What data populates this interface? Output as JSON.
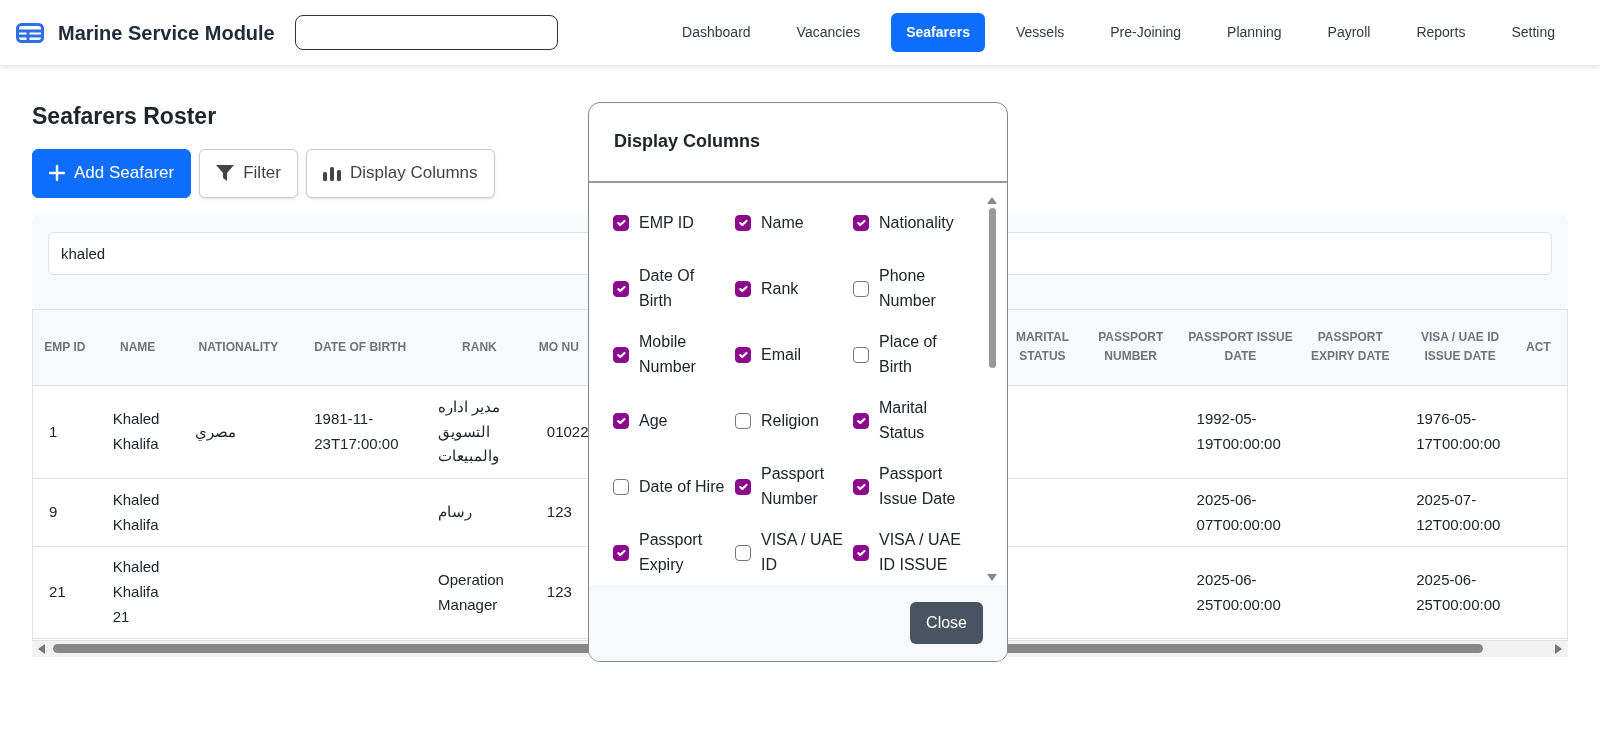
{
  "navbar": {
    "title": "Marine Service Module",
    "links": [
      {
        "label": "Dashboard",
        "selected": false
      },
      {
        "label": "Vacancies",
        "selected": false
      },
      {
        "label": "Seafarers",
        "selected": true
      },
      {
        "label": "Vessels",
        "selected": false
      },
      {
        "label": "Pre-Joining",
        "selected": false
      },
      {
        "label": "Planning",
        "selected": false
      },
      {
        "label": "Payroll",
        "selected": false
      },
      {
        "label": "Reports",
        "selected": false
      },
      {
        "label": "Setting",
        "selected": false
      }
    ]
  },
  "page": {
    "title": "Seafarers Roster",
    "buttons": [
      {
        "kind": "add",
        "label": "Add Seafarer"
      },
      {
        "kind": "filter",
        "label": "Filter"
      },
      {
        "kind": "columns",
        "label": "Display Columns"
      }
    ],
    "search": {
      "value": "khaled"
    }
  },
  "table": {
    "columns_left": [
      "EMP ID",
      "NAME",
      "NATIONALITY",
      "DATE OF BIRTH",
      "RANK",
      "MO NU"
    ],
    "columns_right": [
      "MARITAL STATUS",
      "PASSPORT NUMBER",
      "PASSPORT ISSUE DATE",
      "PASSPORT EXPIRY DATE",
      "VISA / UAE ID ISSUE DATE",
      "ACT"
    ],
    "rows": [
      {
        "emp_id": "1",
        "name": "Khaled Khalifa",
        "nationality": "مصري",
        "date_of_birth": "1981-11-23T17:00:00",
        "rank": "مدير اداره التسويق والمبيعات",
        "mobile": "01022",
        "passport_issue_date": "1992-05-19T00:00:00",
        "visa_issue_date": "1976-05-17T00:00:00"
      },
      {
        "emp_id": "9",
        "name": "Khaled Khalifa",
        "rank": "رسام",
        "mobile": "123",
        "passport_issue_date": "2025-06-07T00:00:00",
        "visa_issue_date": "2025-07-12T00:00:00"
      },
      {
        "emp_id": "21",
        "name": "Khaled Khalifa 21",
        "rank": "Operation Manager",
        "mobile": "123",
        "passport_issue_date": "2025-06-25T00:00:00",
        "visa_issue_date": "2025-06-25T00:00:00"
      }
    ]
  },
  "modal": {
    "title": "Display Columns",
    "options": [
      {
        "label": "EMP ID",
        "checked": true
      },
      {
        "label": "Name",
        "checked": true
      },
      {
        "label": "Nationality",
        "checked": true
      },
      {
        "label": "Date Of Birth",
        "checked": true
      },
      {
        "label": "Rank",
        "checked": true
      },
      {
        "label": "Phone Number",
        "checked": false
      },
      {
        "label": "Mobile Number",
        "checked": true
      },
      {
        "label": "Email",
        "checked": true
      },
      {
        "label": "Place of Birth",
        "checked": false
      },
      {
        "label": "Age",
        "checked": true
      },
      {
        "label": "Religion",
        "checked": false
      },
      {
        "label": "Marital Status",
        "checked": true
      },
      {
        "label": "Date of Hire",
        "checked": false
      },
      {
        "label": "Passport Number",
        "checked": true
      },
      {
        "label": "Passport Issue Date",
        "checked": true
      },
      {
        "label": "Passport Expiry",
        "checked": true
      },
      {
        "label": "VISA / UAE ID",
        "checked": false
      },
      {
        "label": "VISA / UAE ID ISSUE",
        "checked": true
      }
    ],
    "close_label": "Close"
  }
}
